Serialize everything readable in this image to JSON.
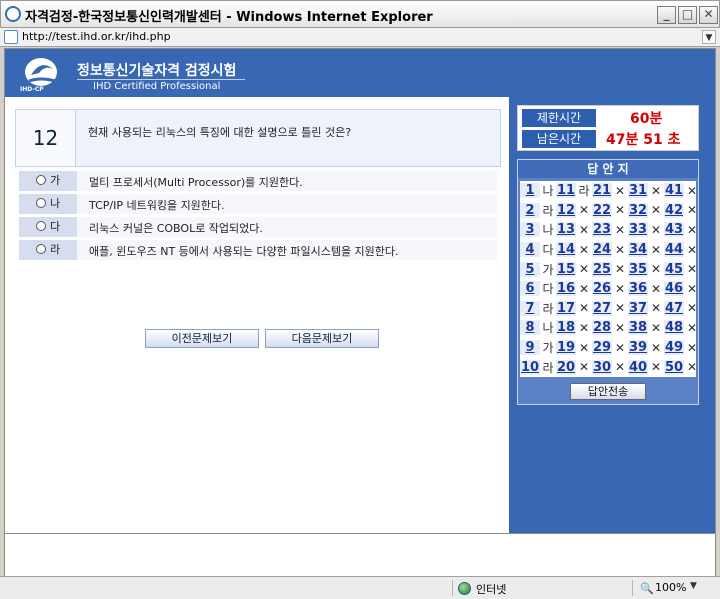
{
  "window": {
    "title": "자격검정-한국정보통신인력개발센터 - Windows Internet Explorer",
    "url": "http://test.ihd.or.kr/ihd.php",
    "minimize": "_",
    "maximize": "□",
    "close": "✕"
  },
  "header": {
    "logo_text": "IHD-CP",
    "title": "정보통신기술자격 검정시험",
    "subtitle": "IHD Certified Professional"
  },
  "question": {
    "number": "12",
    "text": "현재 사용되는 리눅스의 특징에 대한 설명으로 틀린 것은?",
    "options": [
      {
        "label": "가",
        "text": "멀티 프로세서(Multi Processor)를 지원한다."
      },
      {
        "label": "나",
        "text": "TCP/IP 네트워킹을 지원한다."
      },
      {
        "label": "다",
        "text": "리눅스 커널은 COBOL로 작업되었다."
      },
      {
        "label": "라",
        "text": "애플, 윈도우즈 NT 등에서 사용되는 다양한 파일시스템을 지원한다."
      }
    ],
    "prev_button": "이전문제보기",
    "next_button": "다음문제보기"
  },
  "timer": {
    "limit_label": "제한시간",
    "limit_value": "60분",
    "remain_label": "남은시간",
    "remain_value": "47분 51 초"
  },
  "answer_sheet": {
    "title": "답 안 지",
    "rows": [
      [
        {
          "n": "1",
          "a": "나"
        },
        {
          "n": "11",
          "a": "라"
        },
        {
          "n": "21",
          "a": "✕"
        },
        {
          "n": "31",
          "a": "✕"
        },
        {
          "n": "41",
          "a": "✕"
        }
      ],
      [
        {
          "n": "2",
          "a": "라"
        },
        {
          "n": "12",
          "a": "✕"
        },
        {
          "n": "22",
          "a": "✕"
        },
        {
          "n": "32",
          "a": "✕"
        },
        {
          "n": "42",
          "a": "✕"
        }
      ],
      [
        {
          "n": "3",
          "a": "나"
        },
        {
          "n": "13",
          "a": "✕"
        },
        {
          "n": "23",
          "a": "✕"
        },
        {
          "n": "33",
          "a": "✕"
        },
        {
          "n": "43",
          "a": "✕"
        }
      ],
      [
        {
          "n": "4",
          "a": "다"
        },
        {
          "n": "14",
          "a": "✕"
        },
        {
          "n": "24",
          "a": "✕"
        },
        {
          "n": "34",
          "a": "✕"
        },
        {
          "n": "44",
          "a": "✕"
        }
      ],
      [
        {
          "n": "5",
          "a": "가"
        },
        {
          "n": "15",
          "a": "✕"
        },
        {
          "n": "25",
          "a": "✕"
        },
        {
          "n": "35",
          "a": "✕"
        },
        {
          "n": "45",
          "a": "✕"
        }
      ],
      [
        {
          "n": "6",
          "a": "다"
        },
        {
          "n": "16",
          "a": "✕"
        },
        {
          "n": "26",
          "a": "✕"
        },
        {
          "n": "36",
          "a": "✕"
        },
        {
          "n": "46",
          "a": "✕"
        }
      ],
      [
        {
          "n": "7",
          "a": "라"
        },
        {
          "n": "17",
          "a": "✕"
        },
        {
          "n": "27",
          "a": "✕"
        },
        {
          "n": "37",
          "a": "✕"
        },
        {
          "n": "47",
          "a": "✕"
        }
      ],
      [
        {
          "n": "8",
          "a": "나"
        },
        {
          "n": "18",
          "a": "✕"
        },
        {
          "n": "28",
          "a": "✕"
        },
        {
          "n": "38",
          "a": "✕"
        },
        {
          "n": "48",
          "a": "✕"
        }
      ],
      [
        {
          "n": "9",
          "a": "가"
        },
        {
          "n": "19",
          "a": "✕"
        },
        {
          "n": "29",
          "a": "✕"
        },
        {
          "n": "39",
          "a": "✕"
        },
        {
          "n": "49",
          "a": "✕"
        }
      ],
      [
        {
          "n": "10",
          "a": "라"
        },
        {
          "n": "20",
          "a": "✕"
        },
        {
          "n": "30",
          "a": "✕"
        },
        {
          "n": "40",
          "a": "✕"
        },
        {
          "n": "50",
          "a": "✕"
        }
      ]
    ],
    "submit_button": "답안전송"
  },
  "status": {
    "zone": "인터넷",
    "zoom": "100%"
  },
  "colors": {
    "accent": "#3867b4",
    "time_value": "#d40000",
    "question_number_link": "#1a3a9a"
  }
}
